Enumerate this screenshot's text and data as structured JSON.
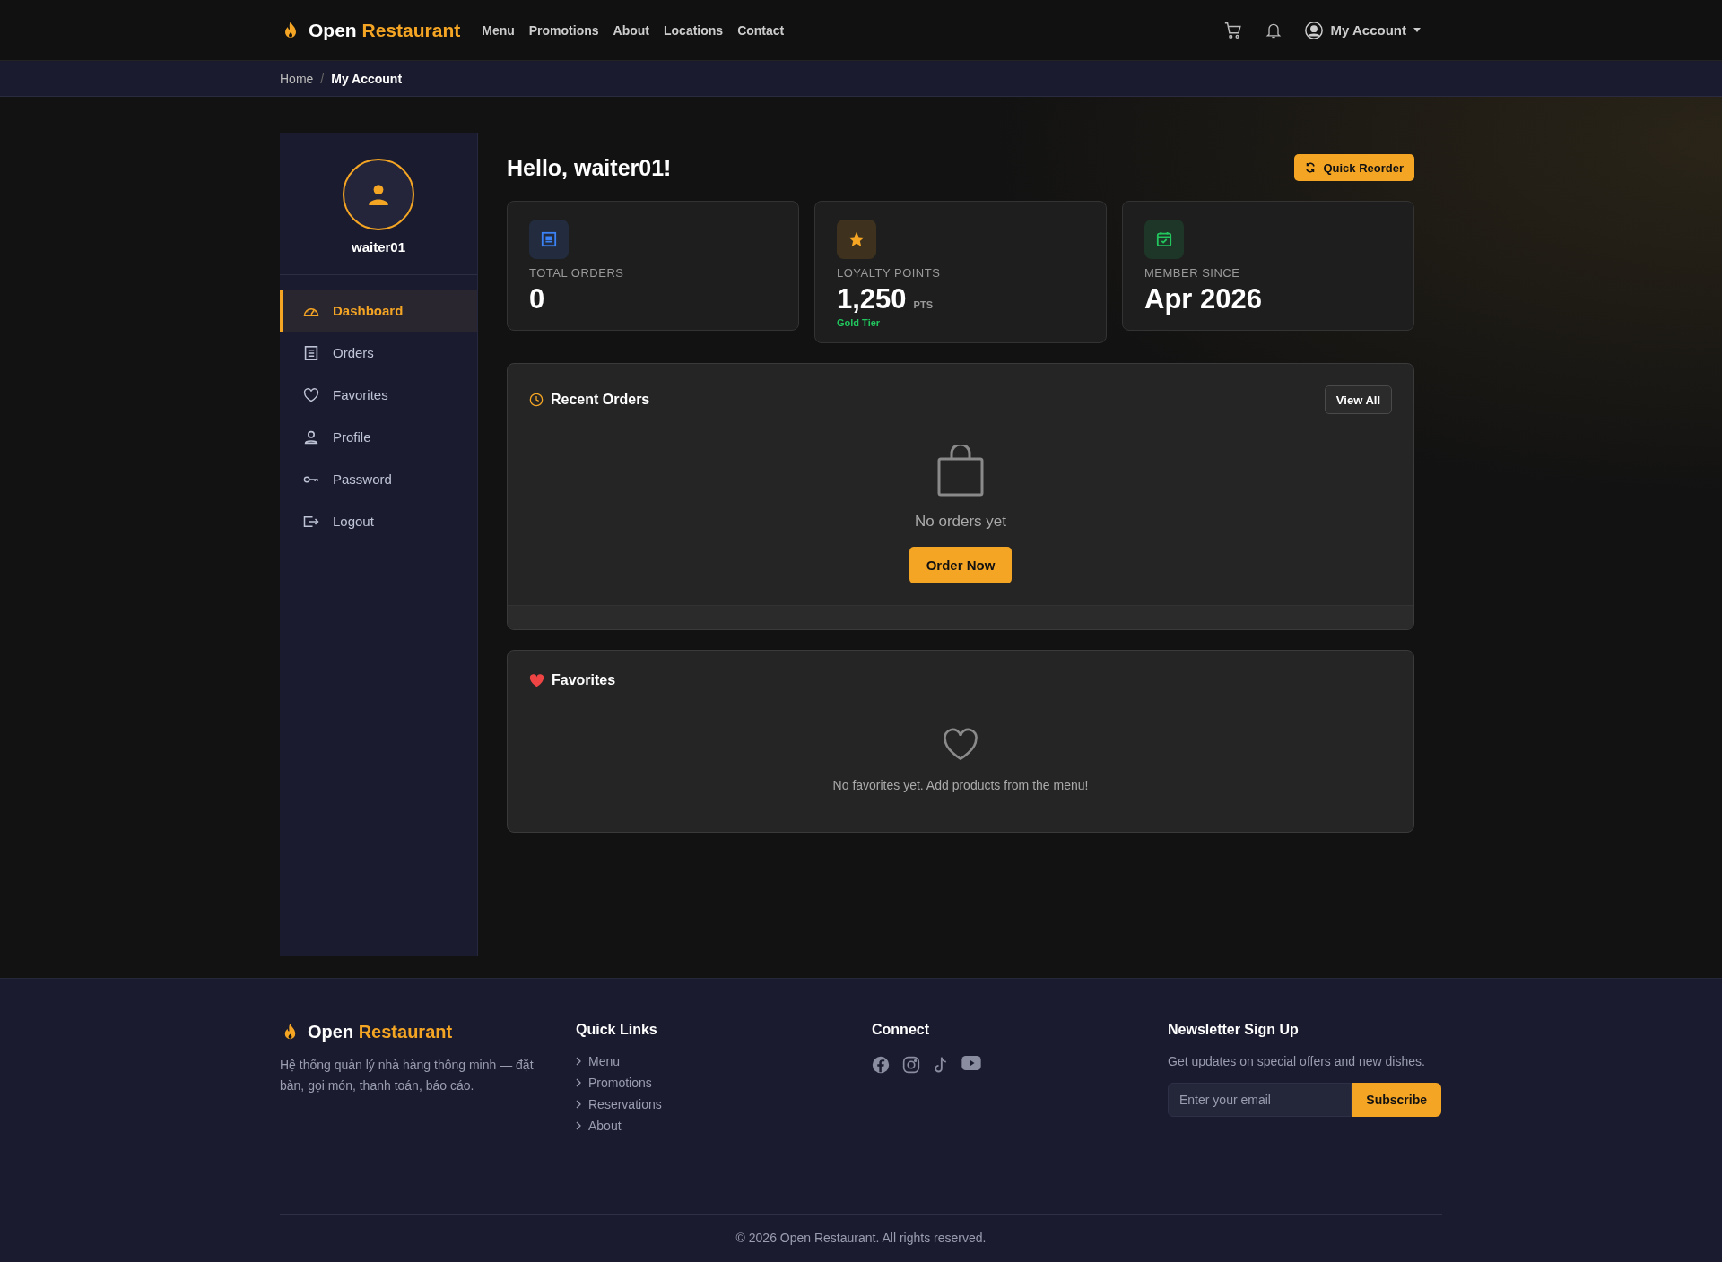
{
  "header": {
    "brand": {
      "first": "Open",
      "second": "Restaurant"
    },
    "nav": [
      "Menu",
      "Promotions",
      "About",
      "Locations",
      "Contact"
    ],
    "account": "My Account"
  },
  "breadcrumb_separator": "/",
  "breadcrumb": [
    {
      "label": "Home",
      "current": false
    },
    {
      "label": "My Account",
      "current": true
    }
  ],
  "sidebar": {
    "username": "waiter01",
    "items": [
      {
        "label": "Dashboard",
        "selected": true
      },
      {
        "label": "Orders",
        "selected": false
      },
      {
        "label": "Favorites",
        "selected": false
      },
      {
        "label": "Profile",
        "selected": false
      },
      {
        "label": "Password",
        "selected": false
      },
      {
        "label": "Logout",
        "selected": false
      }
    ]
  },
  "greeting": "Hello, waiter01!",
  "quick_reorder": "Quick Reorder",
  "stats": [
    {
      "label": "TOTAL ORDERS",
      "value": "0",
      "color": "#3b82f6"
    },
    {
      "label": "LOYALTY POINTS",
      "value": "1,250",
      "unit": "PTS",
      "note": "Gold Tier",
      "color": "#f5a524"
    },
    {
      "label": "MEMBER SINCE",
      "value": "Apr 2026",
      "color": "#22c55e"
    }
  ],
  "recent_orders": {
    "title": "Recent Orders",
    "view_all": "View All",
    "empty": "No orders yet",
    "action": "Order Now"
  },
  "favorites": {
    "title": "Favorites",
    "empty": "No favorites yet. Add products from the menu!"
  },
  "footer": {
    "brand": {
      "first": "Open",
      "second": "Restaurant"
    },
    "description": "Hệ thống quản lý nhà hàng thông minh — đặt bàn, gọi món, thanh toán, báo cáo.",
    "quick_links_title": "Quick Links",
    "quick_links": [
      "Menu",
      "Promotions",
      "Reservations",
      "About"
    ],
    "connect_title": "Connect",
    "newsletter_title": "Newsletter Sign Up",
    "newsletter_text": "Get updates on special offers and new dishes.",
    "email_placeholder": "Enter your email",
    "subscribe": "Subscribe",
    "copyright": "© 2026 Open Restaurant. All rights reserved."
  }
}
